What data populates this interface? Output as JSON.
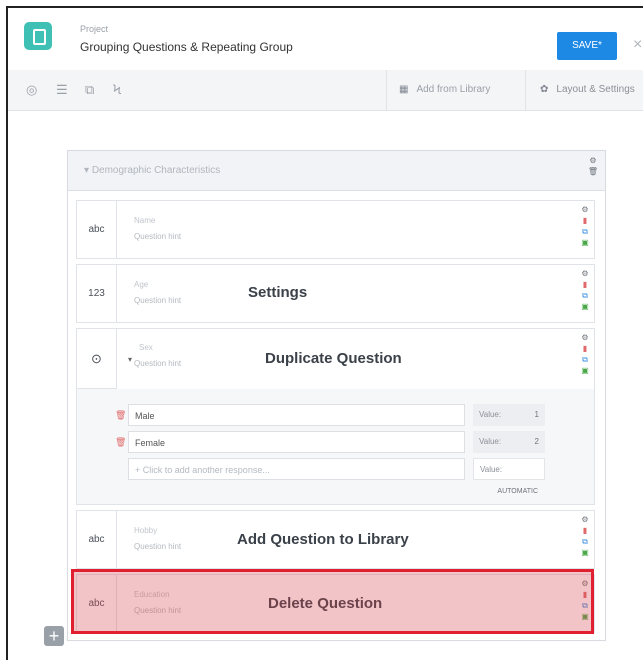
{
  "header": {
    "project_label": "Project",
    "project_title": "Grouping Questions & Repeating Group",
    "save_label": "SAVE*",
    "close_label": "×"
  },
  "toolbar": {
    "add_from_library": "Add from Library",
    "layout_settings": "Layout & Settings"
  },
  "group": {
    "title": "Demographic Characteristics"
  },
  "questions": [
    {
      "type": "abc",
      "name": "Name",
      "hint": "Question hint"
    },
    {
      "type": "123",
      "name": "Age",
      "hint": "Question hint",
      "callout": "Settings"
    },
    {
      "type": "⊙",
      "name": "Sex",
      "hint": "Question hint",
      "callout": "Duplicate Question",
      "responses": [
        {
          "label": "Male",
          "value_label": "Value:",
          "value": "1"
        },
        {
          "label": "Female",
          "value_label": "Value:",
          "value": "2"
        }
      ],
      "add_response": "+ Click to add another response...",
      "add_value_label": "Value:",
      "add_value": "AUTOMATIC"
    },
    {
      "type": "abc",
      "name": "Hobby",
      "hint": "Question hint",
      "callout": "Add Question to Library"
    },
    {
      "type": "abc",
      "name": "Education",
      "hint": "Question hint",
      "callout": "Delete Question"
    }
  ],
  "add_question_button": "+",
  "colors": {
    "save_button": "#1e88e5",
    "logo": "#3ec1b4",
    "highlight_border": "#e02030"
  }
}
